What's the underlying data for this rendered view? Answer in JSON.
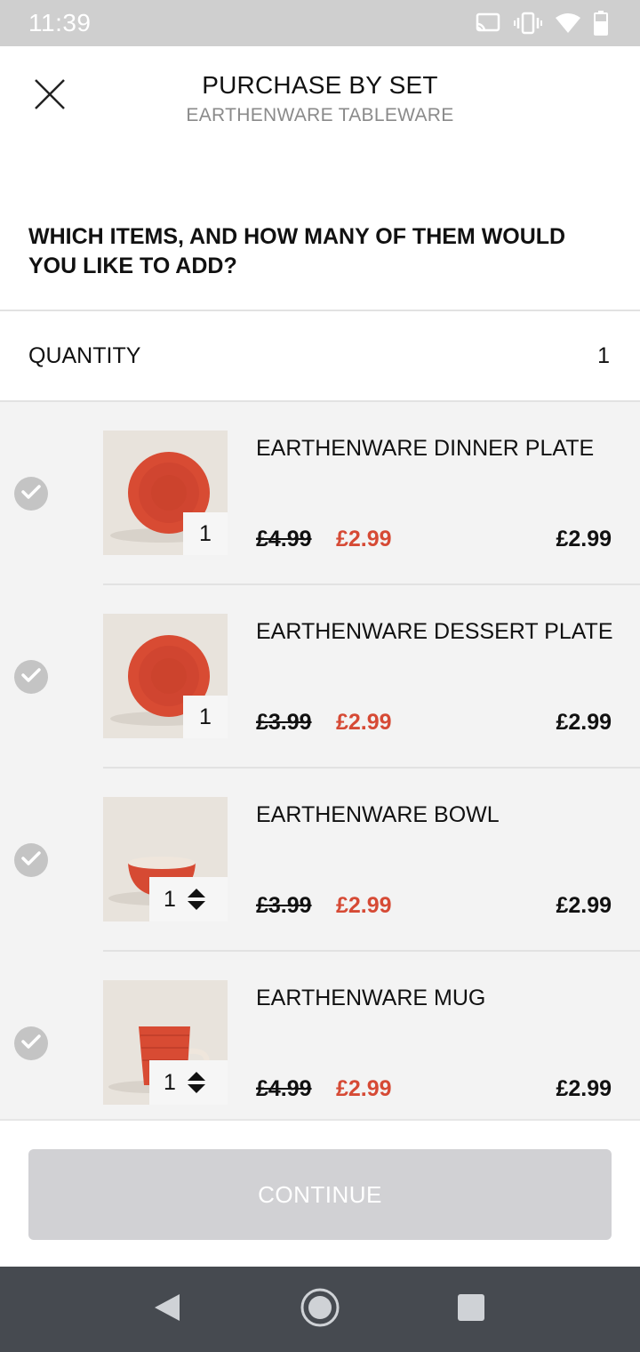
{
  "status_bar": {
    "time": "11:39",
    "icons": [
      "cast-icon",
      "vibrate-icon",
      "wifi-icon",
      "battery-icon"
    ]
  },
  "header": {
    "title": "PURCHASE BY SET",
    "subtitle": "EARTHENWARE TABLEWARE",
    "close_icon": "close-icon"
  },
  "question": "WHICH ITEMS, AND HOW MANY OF THEM WOULD YOU LIKE TO ADD?",
  "quantity": {
    "label": "QUANTITY",
    "value": "1"
  },
  "items": [
    {
      "name": "EARTHENWARE DINNER PLATE",
      "quantity": "1",
      "stepper": false,
      "old_price": "£4.99",
      "new_price": "£2.99",
      "total": "£2.99",
      "selected": true,
      "image": "plate"
    },
    {
      "name": "EARTHENWARE DESSERT PLATE",
      "quantity": "1",
      "stepper": false,
      "old_price": "£3.99",
      "new_price": "£2.99",
      "total": "£2.99",
      "selected": true,
      "image": "plate"
    },
    {
      "name": "EARTHENWARE BOWL",
      "quantity": "1",
      "stepper": true,
      "old_price": "£3.99",
      "new_price": "£2.99",
      "total": "£2.99",
      "selected": true,
      "image": "bowl"
    },
    {
      "name": "EARTHENWARE MUG",
      "quantity": "1",
      "stepper": true,
      "old_price": "£4.99",
      "new_price": "£2.99",
      "total": "£2.99",
      "selected": true,
      "image": "mug"
    }
  ],
  "footer": {
    "continue_label": "CONTINUE"
  },
  "colors": {
    "accent_sale": "#d64a35",
    "button_disabled": "#d1d1d4",
    "check_gray": "#c4c4c4",
    "nav_bar": "#464a50"
  },
  "nav": {
    "back_icon": "back-triangle-icon",
    "home_icon": "home-circle-icon",
    "recents_icon": "recents-square-icon"
  }
}
